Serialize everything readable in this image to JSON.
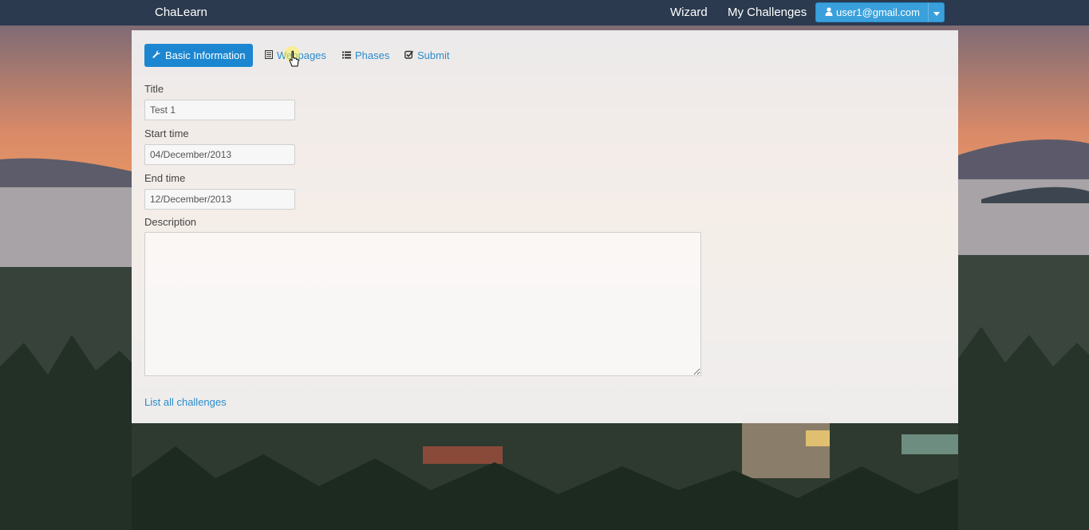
{
  "navbar": {
    "brand": "ChaLearn",
    "links": [
      "Wizard",
      "My Challenges"
    ],
    "user_email": "user1@gmail.com"
  },
  "tabs": [
    {
      "label": "Basic Information",
      "icon": "wrench-icon",
      "active": true
    },
    {
      "label": "Webpages",
      "icon": "document-icon",
      "active": false
    },
    {
      "label": "Phases",
      "icon": "list-icon",
      "active": false
    },
    {
      "label": "Submit",
      "icon": "check-square-icon",
      "active": false
    }
  ],
  "form": {
    "title_label": "Title",
    "title_value": "Test 1",
    "start_label": "Start time",
    "start_value": "04/December/2013",
    "end_label": "End time",
    "end_value": "12/December/2013",
    "description_label": "Description",
    "description_value": ""
  },
  "footer_link": "List all challenges"
}
